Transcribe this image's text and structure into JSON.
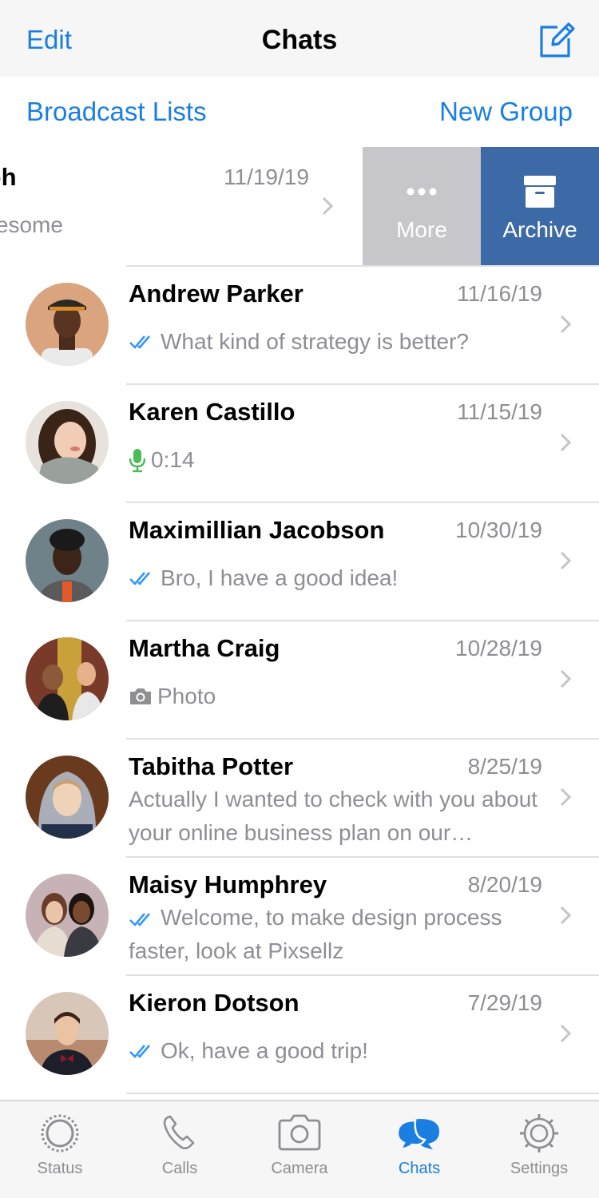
{
  "nav": {
    "edit_label": "Edit",
    "title": "Chats",
    "compose_icon": "compose-icon"
  },
  "sub_bar": {
    "broadcast_label": "Broadcast Lists",
    "new_group_label": "New Group"
  },
  "swiped_chat": {
    "name": "andolph",
    "date": "11/19/19",
    "preview": "m is awesome",
    "actions": {
      "more_label": "More",
      "archive_label": "Archive"
    }
  },
  "chats": [
    {
      "name": "Andrew Parker",
      "date": "11/16/19",
      "preview": "What kind of strategy is better?",
      "status": "read"
    },
    {
      "name": "Karen Castillo",
      "date": "11/15/19",
      "preview": "0:14",
      "status": "voice"
    },
    {
      "name": "Maximillian Jacobson",
      "date": "10/30/19",
      "preview": "Bro, I have a good idea!",
      "status": "read"
    },
    {
      "name": "Martha Craig",
      "date": "10/28/19",
      "preview": "Photo",
      "status": "photo"
    },
    {
      "name": "Tabitha Potter",
      "date": "8/25/19",
      "preview": "Actually I wanted to check with you about your online business plan on our…",
      "status": "none"
    },
    {
      "name": "Maisy Humphrey",
      "date": "8/20/19",
      "preview": "Welcome, to make design process faster, look at Pixsellz",
      "status": "read"
    },
    {
      "name": "Kieron Dotson",
      "date": "7/29/19",
      "preview": "Ok, have a good trip!",
      "status": "read"
    }
  ],
  "tabs": [
    {
      "label": "Status",
      "icon": "status-icon",
      "active": false
    },
    {
      "label": "Calls",
      "icon": "phone-icon",
      "active": false
    },
    {
      "label": "Camera",
      "icon": "camera-icon",
      "active": false
    },
    {
      "label": "Chats",
      "icon": "chats-icon",
      "active": true
    },
    {
      "label": "Settings",
      "icon": "gear-icon",
      "active": false
    }
  ],
  "colors": {
    "accent": "#1a7fe1",
    "archive": "#3c6aa6",
    "more": "#c6c6cb",
    "voice_green": "#4cba58",
    "read_check": "#3497f9"
  }
}
